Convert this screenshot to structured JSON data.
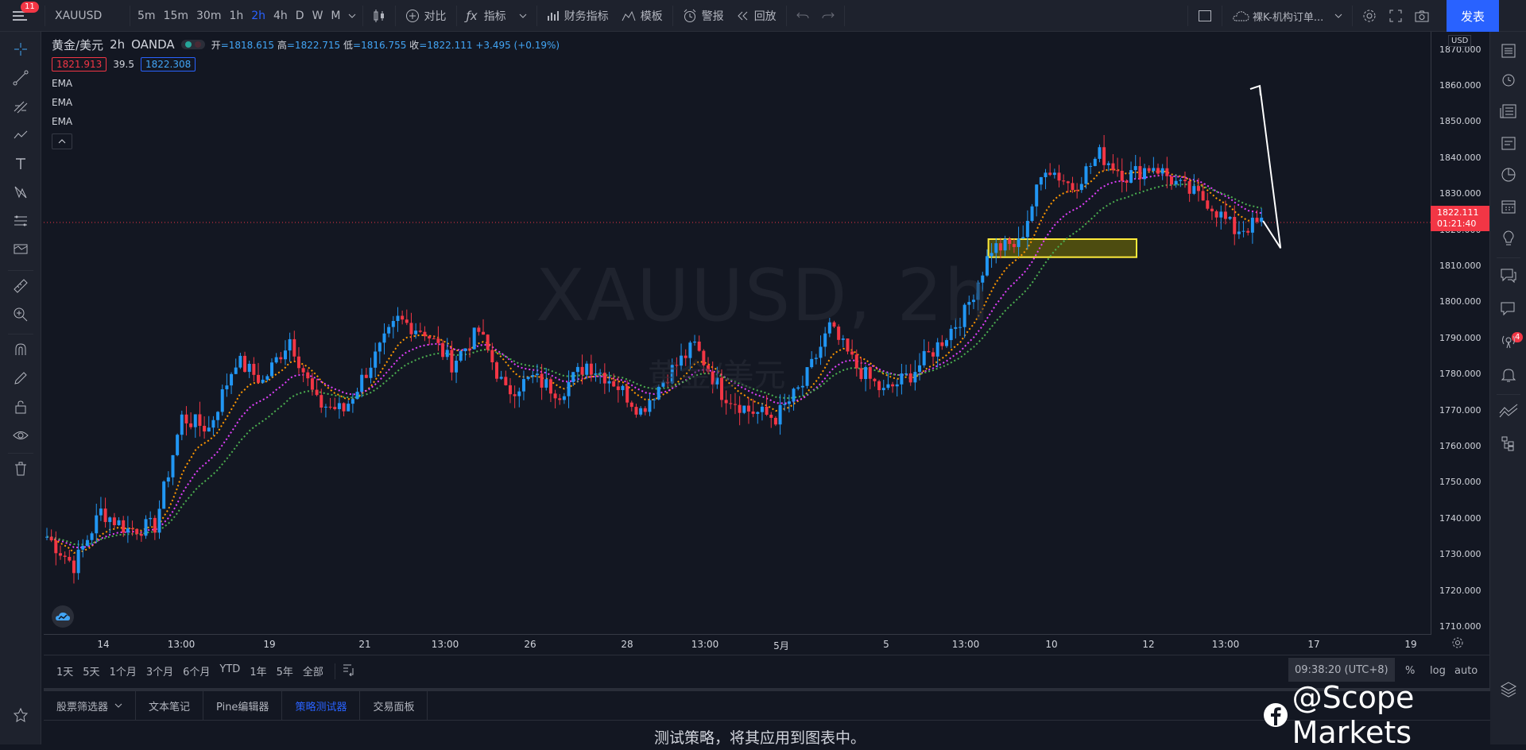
{
  "topbar": {
    "menu_badge": "11",
    "symbol": "XAUUSD",
    "intervals": [
      "5m",
      "15m",
      "30m",
      "1h",
      "2h",
      "4h",
      "D",
      "W",
      "M"
    ],
    "active_interval": "2h",
    "compare_label": "对比",
    "indicators_label": "指标",
    "financials_label": "财务指标",
    "templates_label": "模板",
    "alert_label": "警报",
    "replay_label": "回放",
    "layout_name": "裸K-机构订单...",
    "publish_label": "发表"
  },
  "legend": {
    "symbol_name": "黄金/美元",
    "interval": "2h",
    "source": "OANDA",
    "open_label": "开",
    "open": "=1818.615",
    "high_label": "高",
    "high": "=1822.715",
    "low_label": "低",
    "low": "=1816.755",
    "close_label": "收",
    "close": "=1822.111",
    "change": "+3.495 (+0.19%)",
    "bid": "1821.913",
    "spread": "39.5",
    "ask": "1822.308",
    "indicators": [
      "EMA",
      "EMA",
      "EMA"
    ]
  },
  "watermark": {
    "line1": "XAUUSD, 2h",
    "line2": "黄金/美元"
  },
  "price_axis": {
    "currency": "USD",
    "labels": [
      "1870.000",
      "1860.000",
      "1850.000",
      "1840.000",
      "1830.000",
      "1820.000",
      "1810.000",
      "1800.000",
      "1790.000",
      "1780.000",
      "1770.000",
      "1760.000",
      "1750.000",
      "1740.000",
      "1730.000",
      "1720.000",
      "1710.000"
    ],
    "last_price": "1822.111",
    "countdown": "01:21:40"
  },
  "time_axis": {
    "labels": [
      "14",
      "13:00",
      "19",
      "21",
      "13:00",
      "26",
      "28",
      "13:00",
      "5月",
      "5",
      "13:00",
      "10",
      "12",
      "13:00",
      "17",
      "19"
    ]
  },
  "range_bar": {
    "ranges": [
      "1天",
      "5天",
      "1个月",
      "3个月",
      "6个月",
      "YTD",
      "1年",
      "5年",
      "全部"
    ],
    "clock": "09:38:20 (UTC+8)",
    "percent": "%",
    "log": "log",
    "auto": "auto"
  },
  "bottom_panel": {
    "tabs": [
      "股票筛选器",
      "文本笔记",
      "Pine编辑器",
      "策略测试器",
      "交易面板"
    ],
    "active_tab": "策略测试器",
    "message": "测试策略，将其应用到图表中。"
  },
  "overlay": {
    "brand": "@Scope Markets"
  },
  "rightbar": {
    "badge": "4"
  },
  "colors": {
    "up": "#2196f3",
    "down": "#f23645",
    "ema_fast": "#ff9800",
    "ema_mid": "#e040fb",
    "ema_slow": "#4caf50",
    "zone_fill": "#5c5a0c",
    "zone_border": "#ffeb3b",
    "accent": "#2962ff"
  },
  "chart_data": {
    "type": "candlestick",
    "title": "XAUUSD, 2h",
    "ylim": [
      1708,
      1875
    ],
    "series_close_anchors": [
      [
        0,
        1735
      ],
      [
        6,
        1727
      ],
      [
        12,
        1742
      ],
      [
        18,
        1737
      ],
      [
        24,
        1738
      ],
      [
        30,
        1768
      ],
      [
        36,
        1765
      ],
      [
        42,
        1784
      ],
      [
        48,
        1778
      ],
      [
        54,
        1790
      ],
      [
        60,
        1772
      ],
      [
        66,
        1770
      ],
      [
        72,
        1783
      ],
      [
        78,
        1795
      ],
      [
        84,
        1792
      ],
      [
        90,
        1783
      ],
      [
        96,
        1792
      ],
      [
        102,
        1775
      ],
      [
        108,
        1779
      ],
      [
        114,
        1775
      ],
      [
        120,
        1783
      ],
      [
        126,
        1778
      ],
      [
        132,
        1770
      ],
      [
        138,
        1780
      ],
      [
        144,
        1788
      ],
      [
        150,
        1775
      ],
      [
        156,
        1770
      ],
      [
        162,
        1768
      ],
      [
        168,
        1777
      ],
      [
        174,
        1793
      ],
      [
        180,
        1782
      ],
      [
        186,
        1775
      ],
      [
        192,
        1780
      ],
      [
        198,
        1788
      ],
      [
        204,
        1797
      ],
      [
        210,
        1815
      ],
      [
        216,
        1816
      ],
      [
        222,
        1838
      ],
      [
        228,
        1832
      ],
      [
        234,
        1841
      ],
      [
        240,
        1835
      ],
      [
        246,
        1838
      ],
      [
        252,
        1832
      ],
      [
        258,
        1828
      ],
      [
        264,
        1820
      ],
      [
        270,
        1822
      ]
    ],
    "support_zone": [
      1812.5,
      1817.5
    ],
    "current_price": 1822.111,
    "projection_target": 1860
  }
}
